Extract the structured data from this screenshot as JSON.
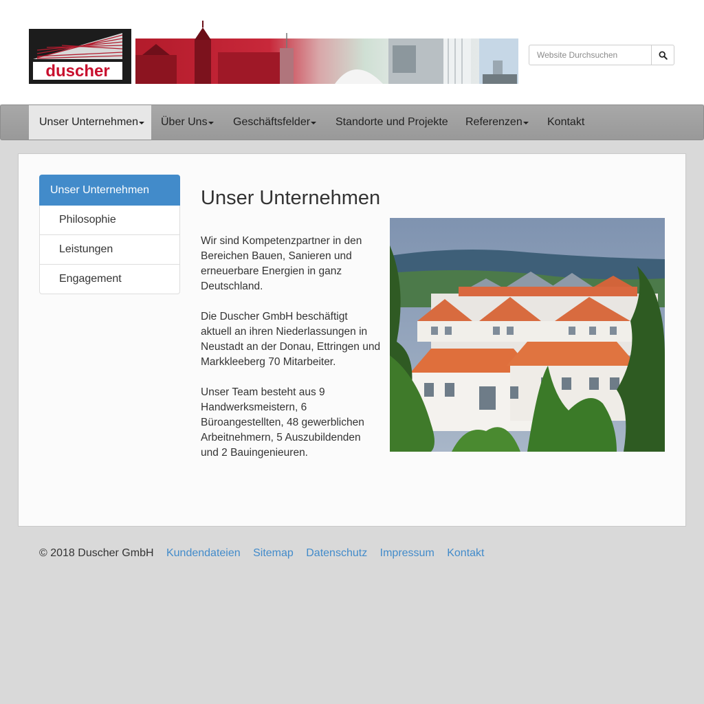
{
  "header": {
    "logo_text": "duscher",
    "search": {
      "placeholder": "Website Durchsuchen"
    }
  },
  "nav": {
    "items": [
      {
        "label": "Unser Unternehmen",
        "dropdown": true,
        "active": true
      },
      {
        "label": "Über Uns",
        "dropdown": true
      },
      {
        "label": "Geschäftsfelder",
        "dropdown": true
      },
      {
        "label": "Standorte und Projekte",
        "dropdown": false
      },
      {
        "label": "Referenzen",
        "dropdown": true
      },
      {
        "label": "Kontakt",
        "dropdown": false
      }
    ]
  },
  "sidebar": {
    "header": "Unser Unternehmen",
    "items": [
      {
        "label": "Philosophie"
      },
      {
        "label": "Leistungen"
      },
      {
        "label": "Engagement"
      }
    ]
  },
  "main": {
    "title": "Unser Unternehmen",
    "paragraphs": [
      "Wir sind Kompetenzpartner in den Bereichen Bauen, Sanieren und erneuerbare Energien in ganz Deutschland.",
      "Die Duscher GmbH beschäftigt aktuell an ihren Niederlassungen in Neustadt an der Donau, Ettringen und Markkleeberg 70 Mitarbeiter.",
      "Unser Team besteht aus 9 Handwerksmeistern, 6 Büroangestellten, 48 gewerblichen Arbeitnehmern, 5 Auszubildenden und 2 Bauingenieuren."
    ]
  },
  "footer": {
    "copyright": "© 2018 Duscher GmbH",
    "links": [
      "Kundendateien",
      "Sitemap",
      "Datenschutz",
      "Impressum",
      "Kontakt"
    ]
  },
  "colors": {
    "accent": "#428bca",
    "nav_bg": "#9f9f9f",
    "page_bg": "#d9d9d9",
    "logo_red": "#c8102e"
  }
}
